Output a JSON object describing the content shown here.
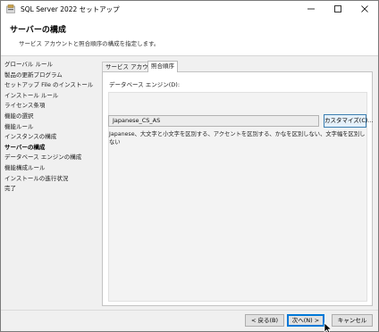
{
  "window": {
    "title": "SQL Server 2022 セットアップ"
  },
  "header": {
    "title": "サーバーの構成",
    "subtitle": "サービス アカウントと照合順序の構成を指定します。"
  },
  "nav": {
    "items": [
      {
        "label": "グローバル ルール"
      },
      {
        "label": "製品の更新プログラム"
      },
      {
        "label": "セットアップ File のインストール"
      },
      {
        "label": "インストール ルール"
      },
      {
        "label": "ライセンス条項"
      },
      {
        "label": "機能の選択"
      },
      {
        "label": "機能ルール"
      },
      {
        "label": "インスタンスの構成"
      },
      {
        "label": "サーバーの構成"
      },
      {
        "label": "データベース エンジンの構成"
      },
      {
        "label": "機能構成ルール"
      },
      {
        "label": "インストールの進行状況"
      },
      {
        "label": "完了"
      }
    ]
  },
  "tabs": {
    "service_accounts": "サービス アカウント",
    "collation": "照合順序"
  },
  "collation": {
    "section_label": "データベース エンジン(D):",
    "value": "Japanese_CS_AS",
    "customize_label": "カスタマイズ(C)...",
    "description": "Japanese、大文字と小文字を区別する、アクセントを区別する、かなを区別しない、文字幅を区別しない"
  },
  "footer": {
    "back_label": "< 戻る(B)",
    "next_label": "次へ(N) >",
    "cancel_label": "キャンセル"
  },
  "icons": {
    "app": "sql-server-setup-icon",
    "minimize": "minimize-icon",
    "maximize": "maximize-icon",
    "close": "close-icon",
    "cursor": "mouse-pointer-icon"
  },
  "colors": {
    "accent": "#0078d7",
    "header_bg": "#ffffff",
    "window_bg": "#f0f0f0"
  }
}
